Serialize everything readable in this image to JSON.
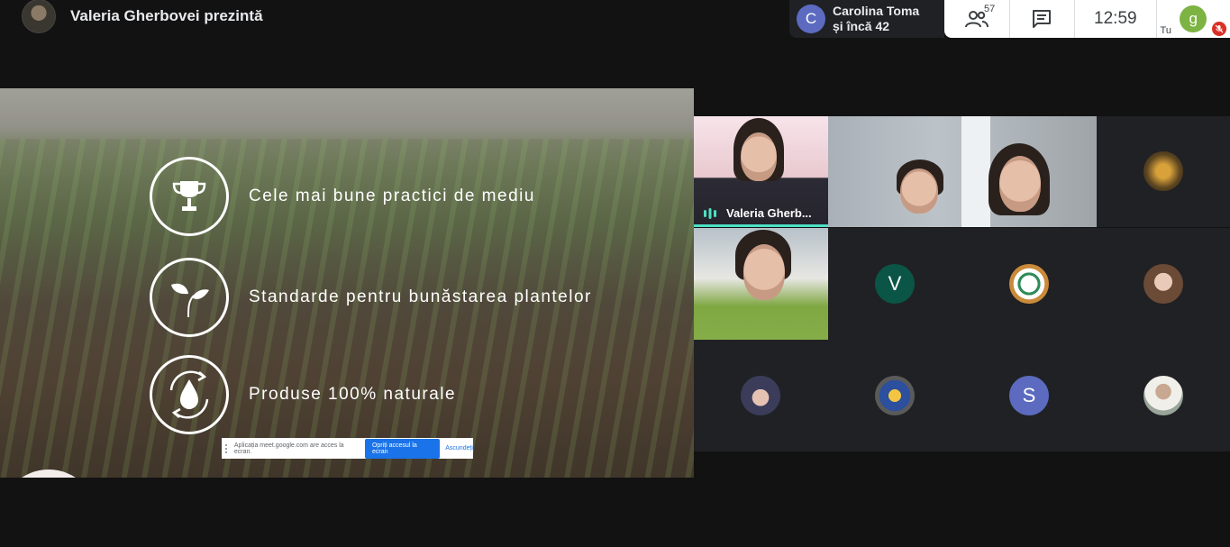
{
  "header": {
    "presenter_label": "Valeria Gherbovei prezintă"
  },
  "notification": {
    "avatar_letter": "C",
    "line1": "Carolina Toma",
    "line2": "și încă 42"
  },
  "controls": {
    "people_count": "57",
    "time": "12:59",
    "self_avatar_letter": "g",
    "self_label": "Tu"
  },
  "icons": [
    "people-icon",
    "chat-icon",
    "mic-off-icon",
    "trophy-icon",
    "sprout-icon",
    "water-drop-icon",
    "audio-wave-icon"
  ],
  "slide": {
    "items": [
      {
        "text": "Cele mai bune practici de mediu"
      },
      {
        "text": "Standarde pentru bunăstarea plantelor"
      },
      {
        "text": "Produse 100% naturale"
      }
    ]
  },
  "share_banner": {
    "message": "Aplicația meet.google.com are acces la ecran.",
    "stop_label": "Opriți accesul la ecran",
    "hide_label": "Ascundeți"
  },
  "participants": {
    "speaker_name": "Valeria Gherb...",
    "letter_v": "V",
    "letter_s": "S"
  },
  "colors": {
    "accent_speaking": "#4de0c4",
    "avatar_c": "#5c6bc0",
    "avatar_g": "#7cb342",
    "avatar_v": "#0b5546",
    "avatar_s": "#5c6bc0",
    "stop_button": "#1a73e8"
  }
}
